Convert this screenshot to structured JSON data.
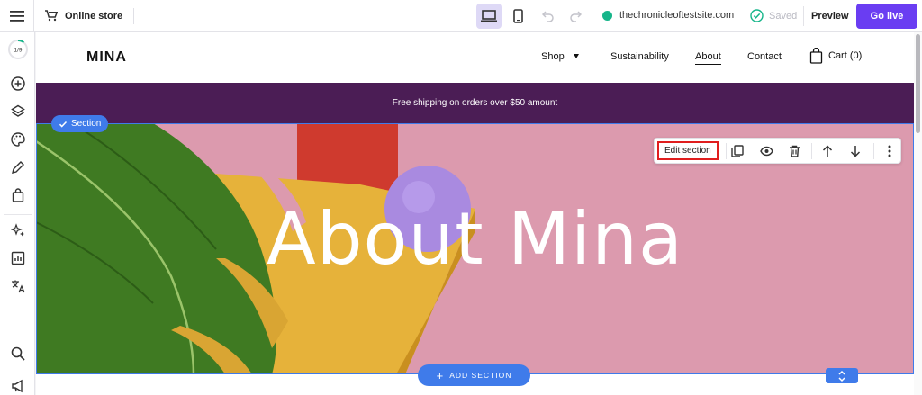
{
  "topbar": {
    "menu_icon": "hamburger-icon",
    "store_icon": "cart-icon",
    "store_label": "Online store",
    "devices": [
      "desktop-icon",
      "mobile-icon"
    ],
    "site_url": "thechronicleoftestsite.com",
    "site_status_color": "#16b58a",
    "saved_label": "Saved",
    "preview_label": "Preview",
    "golive_label": "Go live",
    "accent": "#6a3df2"
  },
  "sidebar": {
    "progress_label": "1/9",
    "items": [
      "add-icon",
      "layers-icon",
      "palette-icon",
      "pencil-icon",
      "shopping-bag-icon",
      "sparkle-icon",
      "analytics-icon",
      "translate-icon",
      "search-icon",
      "megaphone-icon"
    ]
  },
  "site": {
    "logo": "MINA",
    "nav": {
      "shop": "Shop",
      "sustainability": "Sustainability",
      "about": "About",
      "contact": "Contact",
      "cart": "Cart (0)"
    },
    "announcement": "Free shipping on orders over $50 amount",
    "hero_title": "About Mina"
  },
  "editor": {
    "section_tag": "Section",
    "edit_section": "Edit section",
    "toolbar_icons": [
      "duplicate-icon",
      "eye-icon",
      "trash-icon",
      "arrow-up-icon",
      "arrow-down-icon",
      "more-vertical-icon"
    ],
    "add_section": "ADD SECTION",
    "selection_color": "#3f7bea"
  }
}
